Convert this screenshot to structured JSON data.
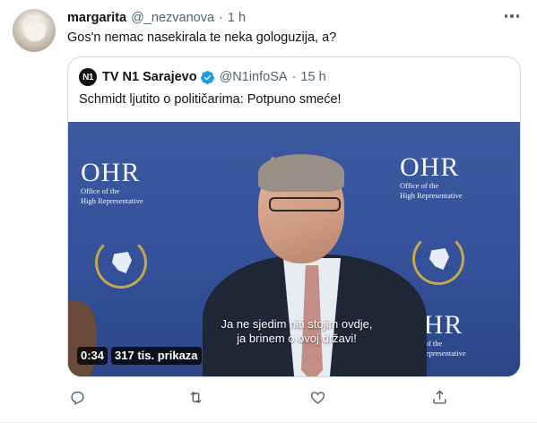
{
  "tweet": {
    "display_name": "margarita",
    "handle": "@_nezvanova",
    "separator": "·",
    "time": "1 h",
    "text": "Gos'n nemac nasekirala te neka gologuzija, a?"
  },
  "quote": {
    "logo_text": "N1",
    "display_name": "TV N1 Sarajevo",
    "handle": "@N1infoSA",
    "separator": "·",
    "time": "15 h",
    "text": "Schmidt ljutito o političarima: Potpuno smeće!"
  },
  "video": {
    "backdrop_logo": "OHR",
    "backdrop_line1": "Office of the",
    "backdrop_line2": "High Representative",
    "subtitle_line1": "Ja ne sjedim niti stojim ovdje,",
    "subtitle_line2": "ja brinem o ovoj državi!",
    "duration": "0:34",
    "views": "317 tis. prikaza"
  },
  "icons": {
    "reply": "reply-icon",
    "retweet": "retweet-icon",
    "like": "heart-icon",
    "share": "share-icon",
    "more": "more-icon",
    "verified": "verified-badge-icon"
  },
  "colors": {
    "text_primary": "#0f1419",
    "text_secondary": "#536471",
    "border": "#cfd9de",
    "verified": "#1d9bf0",
    "video_backdrop": "#34519a"
  }
}
